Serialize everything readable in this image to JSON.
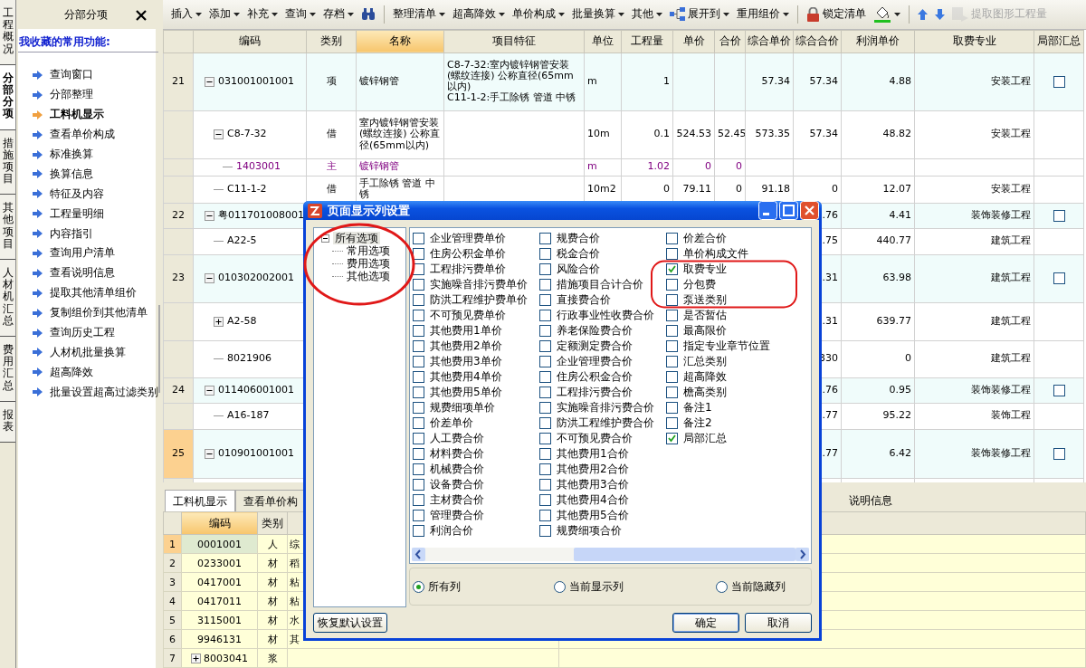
{
  "vertical_tabs": [
    {
      "label": "工程概况",
      "selected": false
    },
    {
      "label": "分部分项",
      "selected": true
    },
    {
      "label": "措施项目",
      "selected": false
    },
    {
      "label": "其他项目",
      "selected": false
    },
    {
      "label": "人材机汇总",
      "selected": false
    },
    {
      "label": "费用汇总",
      "selected": false
    },
    {
      "label": "报表",
      "selected": false
    }
  ],
  "side_panel": {
    "title": "分部分项",
    "favorites_title": "我收藏的常用功能:",
    "items": [
      {
        "label": "查询窗口",
        "selected": false
      },
      {
        "label": "分部整理",
        "selected": false
      },
      {
        "label": "工料机显示",
        "selected": true
      },
      {
        "label": "查看单价构成",
        "selected": false
      },
      {
        "label": "标准换算",
        "selected": false
      },
      {
        "label": "换算信息",
        "selected": false
      },
      {
        "label": "特征及内容",
        "selected": false
      },
      {
        "label": "工程量明细",
        "selected": false
      },
      {
        "label": "内容指引",
        "selected": false
      },
      {
        "label": "查询用户清单",
        "selected": false
      },
      {
        "label": "查看说明信息",
        "selected": false
      },
      {
        "label": "提取其他清单组价",
        "selected": false
      },
      {
        "label": "复制组价到其他清单",
        "selected": false
      },
      {
        "label": "查询历史工程",
        "selected": false
      },
      {
        "label": "人材机批量换算",
        "selected": false
      },
      {
        "label": "超高降效",
        "selected": false
      },
      {
        "label": "批量设置超高过滤类别",
        "selected": false
      }
    ]
  },
  "toolbar": {
    "groups": [
      [
        {
          "kind": "menu",
          "label": "插入",
          "disabled": false
        },
        {
          "kind": "menu",
          "label": "添加",
          "disabled": false
        },
        {
          "kind": "menu",
          "label": "补充",
          "disabled": false
        },
        {
          "kind": "menu",
          "label": "查询",
          "disabled": false
        },
        {
          "kind": "menu",
          "label": "存档",
          "disabled": false
        },
        {
          "kind": "find",
          "disabled": false
        }
      ],
      [
        {
          "kind": "menu",
          "label": "整理清单",
          "disabled": false
        },
        {
          "kind": "menu",
          "label": "超高降效",
          "disabled": false
        },
        {
          "kind": "menu",
          "label": "单价构成",
          "disabled": false
        },
        {
          "kind": "menu",
          "label": "批量换算",
          "disabled": false
        },
        {
          "kind": "menu",
          "label": "其他",
          "disabled": false
        },
        {
          "kind": "expand",
          "label": "展开到",
          "disabled": false
        },
        {
          "kind": "menu",
          "label": "重用组价",
          "disabled": false
        }
      ],
      [
        {
          "kind": "lock",
          "label": "锁定清单",
          "disabled": false
        },
        {
          "kind": "fill",
          "disabled": false
        }
      ],
      [
        {
          "kind": "up",
          "disabled": false
        },
        {
          "kind": "down",
          "disabled": false
        },
        {
          "kind": "extract",
          "label": "提取图形工程量",
          "disabled": true
        }
      ]
    ]
  },
  "main_table": {
    "columns": [
      {
        "label": "编码",
        "selected": false
      },
      {
        "label": "类别",
        "selected": false
      },
      {
        "label": "名称",
        "selected": true
      },
      {
        "label": "项目特征",
        "selected": false
      },
      {
        "label": "单位",
        "selected": false
      },
      {
        "label": "工程量",
        "selected": false
      },
      {
        "label": "单价",
        "selected": false
      },
      {
        "label": "合价",
        "selected": false
      },
      {
        "label": "综合单价",
        "selected": false
      },
      {
        "label": "综合合价",
        "selected": false
      },
      {
        "label": "利润单价",
        "selected": false
      },
      {
        "label": "取费专业",
        "selected": false
      },
      {
        "label": "局部汇总",
        "selected": false
      }
    ],
    "rows": [
      {
        "no": "21",
        "kind": "bill",
        "code": "031001001001",
        "expanded": true,
        "selected": false,
        "category": "项",
        "name": "镀锌钢管",
        "features": "C8-7-32:室内镀锌钢管安装(螺纹连接) 公称直径(65mm以内)\nC11-1-2:手工除锈 管道 中锈",
        "unit": "m",
        "quantity": "1",
        "comp_unit_price": "57.34",
        "comp_total": "57.34",
        "profit_unit_price": "4.88",
        "fee_type": "安装工程",
        "summary": {
          "checked": false
        },
        "children": [
          {
            "kind": "quota",
            "code": "C8-7-32",
            "expanded": true,
            "selected": false,
            "category": "借",
            "name": "室内镀锌钢管安装(螺纹连接) 公称直径(65mm以内)",
            "unit": "10m",
            "quantity": "0.1",
            "unit_price": "524.53",
            "total": "52.45",
            "comp_unit_price": "573.35",
            "comp_total": "57.34",
            "profit_unit_price": "48.82",
            "fee_type": "安装工程",
            "children": [
              {
                "kind": "material",
                "code": "1403001",
                "selected": false,
                "category": "主",
                "name": "镀锌钢管",
                "unit": "m",
                "quantity": "1.02",
                "unit_price": "0",
                "total": "0"
              }
            ]
          },
          {
            "kind": "quota",
            "code": "C11-1-2",
            "selected": false,
            "category": "借",
            "name": "手工除锈 管道 中锈",
            "unit": "10m2",
            "quantity": "0",
            "unit_price": "79.11",
            "total": "0",
            "comp_unit_price": "91.18",
            "comp_total": "0",
            "profit_unit_price": "12.07",
            "fee_type": "安装工程"
          }
        ]
      },
      {
        "no": "22",
        "kind": "bill",
        "code": "粤011701008001",
        "expanded": true,
        "selected": false,
        "comp_total": ".76",
        "profit_unit_price": "4.41",
        "fee_type": "装饰装修工程",
        "summary": {
          "checked": false
        },
        "children": [
          {
            "kind": "quota",
            "code": "A22-5",
            "selected": false,
            "comp_total": ".75",
            "profit_unit_price": "440.77",
            "fee_type": "建筑工程"
          }
        ]
      },
      {
        "no": "23",
        "kind": "bill",
        "code": "010302002001",
        "expanded": true,
        "selected": false,
        "comp_total": ".31",
        "profit_unit_price": "63.98",
        "fee_type": "建筑工程",
        "summary": {
          "checked": false
        },
        "children": [
          {
            "kind": "quota",
            "code": "A2-58",
            "expanded": false,
            "selected": false,
            "comp_total": ".31",
            "profit_unit_price": "639.77",
            "fee_type": "建筑工程"
          },
          {
            "kind": "quota",
            "code": "8021906",
            "selected": false,
            "comp_total": "330",
            "profit_unit_price": "0",
            "fee_type": "建筑工程"
          }
        ]
      },
      {
        "no": "24",
        "kind": "bill",
        "code": "011406001001",
        "expanded": true,
        "selected": false,
        "comp_total": ".76",
        "profit_unit_price": "0.95",
        "fee_type": "装饰装修工程",
        "summary": {
          "checked": false
        },
        "children": [
          {
            "kind": "quota",
            "code": "A16-187",
            "selected": false,
            "comp_total": ".77",
            "profit_unit_price": "95.22",
            "fee_type": "装饰工程"
          }
        ]
      },
      {
        "no": "25",
        "kind": "bill",
        "code": "010901001001",
        "expanded": true,
        "selected": true,
        "comp_total": ".77",
        "profit_unit_price": "6.42",
        "fee_type": "装饰装修工程",
        "summary": {
          "checked": false
        }
      }
    ]
  },
  "bottom_panel": {
    "tabs": [
      {
        "label": "工料机显示",
        "selected": true
      },
      {
        "label": "查看单价构",
        "selected": false
      },
      {
        "label": "说明信息",
        "selected": false
      }
    ],
    "columns": [
      "编码",
      "类别"
    ],
    "rows": [
      {
        "no": "1",
        "code": "0001001",
        "type": "人",
        "column_3": "综",
        "selected": true
      },
      {
        "no": "2",
        "code": "0233001",
        "type": "材",
        "column_3": "稻",
        "selected": false
      },
      {
        "no": "3",
        "code": "0417001",
        "type": "材",
        "column_3": "粘",
        "selected": false
      },
      {
        "no": "4",
        "code": "0417011",
        "type": "材",
        "column_3": "粘",
        "selected": false
      },
      {
        "no": "5",
        "code": "3115001",
        "type": "材",
        "column_3": "水",
        "selected": false
      },
      {
        "no": "6",
        "code": "9946131",
        "type": "材",
        "column_3": "其",
        "selected": false
      },
      {
        "no": "7",
        "code": "8003041",
        "type": "浆",
        "expanded": false,
        "selected": false
      }
    ]
  },
  "dialog": {
    "title": "页面显示列设置",
    "tree": {
      "label": "所有选项",
      "expanded": true,
      "selected": true,
      "children": [
        {
          "label": "常用选项",
          "selected": false
        },
        {
          "label": "费用选项",
          "selected": false
        },
        {
          "label": "其他选项",
          "selected": false
        }
      ]
    },
    "option_columns": [
      [
        {
          "label": "企业管理费单价",
          "checked": false
        },
        {
          "label": "住房公积金单价",
          "checked": false
        },
        {
          "label": "工程排污费单价",
          "checked": false
        },
        {
          "label": "实施噪音排污费单价",
          "checked": false
        },
        {
          "label": "防洪工程维护费单价",
          "checked": false
        },
        {
          "label": "不可预见费单价",
          "checked": false
        },
        {
          "label": "其他费用1单价",
          "checked": false
        },
        {
          "label": "其他费用2单价",
          "checked": false
        },
        {
          "label": "其他费用3单价",
          "checked": false
        },
        {
          "label": "其他费用4单价",
          "checked": false
        },
        {
          "label": "其他费用5单价",
          "checked": false
        },
        {
          "label": "规费细项单价",
          "checked": false
        },
        {
          "label": "价差单价",
          "checked": false
        },
        {
          "label": "人工费合价",
          "checked": false
        },
        {
          "label": "材料费合价",
          "checked": false
        },
        {
          "label": "机械费合价",
          "checked": false
        },
        {
          "label": "设备费合价",
          "checked": false
        },
        {
          "label": "主材费合价",
          "checked": false
        },
        {
          "label": "管理费合价",
          "checked": false
        },
        {
          "label": "利润合价",
          "checked": false
        }
      ],
      [
        {
          "label": "规费合价",
          "checked": false
        },
        {
          "label": "税金合价",
          "checked": false
        },
        {
          "label": "风险合价",
          "checked": false
        },
        {
          "label": "措施项目合计合价",
          "checked": false
        },
        {
          "label": "直接费合价",
          "checked": false
        },
        {
          "label": "行政事业性收费合价",
          "checked": false
        },
        {
          "label": "养老保险费合价",
          "checked": false
        },
        {
          "label": "定额测定费合价",
          "checked": false
        },
        {
          "label": "企业管理费合价",
          "checked": false
        },
        {
          "label": "住房公积金合价",
          "checked": false
        },
        {
          "label": "工程排污费合价",
          "checked": false
        },
        {
          "label": "实施噪音排污费合价",
          "checked": false
        },
        {
          "label": "防洪工程维护费合价",
          "checked": false
        },
        {
          "label": "不可预见费合价",
          "checked": false
        },
        {
          "label": "其他费用1合价",
          "checked": false
        },
        {
          "label": "其他费用2合价",
          "checked": false
        },
        {
          "label": "其他费用3合价",
          "checked": false
        },
        {
          "label": "其他费用4合价",
          "checked": false
        },
        {
          "label": "其他费用5合价",
          "checked": false
        },
        {
          "label": "规费细项合价",
          "checked": false
        }
      ],
      [
        {
          "label": "价差合价",
          "checked": false
        },
        {
          "label": "单价构成文件",
          "checked": false
        },
        {
          "label": "取费专业",
          "checked": true
        },
        {
          "label": "分包费",
          "checked": false
        },
        {
          "label": "泵送类别",
          "checked": false
        },
        {
          "label": "是否暂估",
          "checked": false
        },
        {
          "label": "最高限价",
          "checked": false
        },
        {
          "label": "指定专业章节位置",
          "checked": false
        },
        {
          "label": "汇总类别",
          "checked": false
        },
        {
          "label": "超高降效",
          "checked": false
        },
        {
          "label": "檐高类别",
          "checked": false
        },
        {
          "label": "备注1",
          "checked": false
        },
        {
          "label": "备注2",
          "checked": false
        },
        {
          "label": "局部汇总",
          "checked": true
        }
      ]
    ],
    "radios": [
      {
        "label": "所有列",
        "selected": true
      },
      {
        "label": "当前显示列",
        "selected": false
      },
      {
        "label": "当前隐藏列",
        "selected": false
      }
    ],
    "reset_button": "恢复默认设置",
    "ok_button": "确定",
    "cancel_button": "取消"
  }
}
